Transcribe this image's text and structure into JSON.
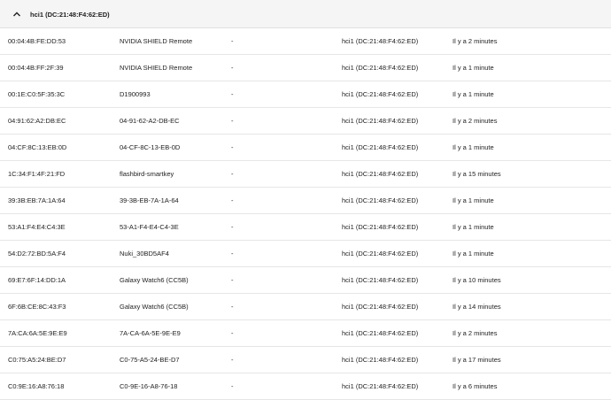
{
  "group": {
    "title": "hci1 (DC:21:48:F4:62:ED)",
    "icon": "chevron-up-icon"
  },
  "rows": [
    {
      "mac": "00:04:4B:FE:DD:53",
      "name": "NVIDIA SHIELD Remote",
      "extra": "-",
      "adapter": "hci1 (DC:21:48:F4:62:ED)",
      "last_seen": "Il y a 2 minutes"
    },
    {
      "mac": "00:04:4B:FF:2F:39",
      "name": "NVIDIA SHIELD Remote",
      "extra": "-",
      "adapter": "hci1 (DC:21:48:F4:62:ED)",
      "last_seen": "Il y a 1 minute"
    },
    {
      "mac": "00:1E:C0:5F:35:3C",
      "name": "D1900993",
      "extra": "-",
      "adapter": "hci1 (DC:21:48:F4:62:ED)",
      "last_seen": "Il y a 1 minute"
    },
    {
      "mac": "04:91:62:A2:DB:EC",
      "name": "04-91-62-A2-DB-EC",
      "extra": "-",
      "adapter": "hci1 (DC:21:48:F4:62:ED)",
      "last_seen": "Il y a 2 minutes"
    },
    {
      "mac": "04:CF:8C:13:EB:0D",
      "name": "04-CF-8C-13-EB-0D",
      "extra": "-",
      "adapter": "hci1 (DC:21:48:F4:62:ED)",
      "last_seen": "Il y a 1 minute"
    },
    {
      "mac": "1C:34:F1:4F:21:FD",
      "name": "flashbird-smartkey",
      "extra": "-",
      "adapter": "hci1 (DC:21:48:F4:62:ED)",
      "last_seen": "Il y a 15 minutes"
    },
    {
      "mac": "39:3B:EB:7A:1A:64",
      "name": "39-3B-EB-7A-1A-64",
      "extra": "-",
      "adapter": "hci1 (DC:21:48:F4:62:ED)",
      "last_seen": "Il y a 1 minute"
    },
    {
      "mac": "53:A1:F4:E4:C4:3E",
      "name": "53-A1-F4-E4-C4-3E",
      "extra": "-",
      "adapter": "hci1 (DC:21:48:F4:62:ED)",
      "last_seen": "Il y a 1 minute"
    },
    {
      "mac": "54:D2:72:BD:5A:F4",
      "name": "Nuki_30BD5AF4",
      "extra": "-",
      "adapter": "hci1 (DC:21:48:F4:62:ED)",
      "last_seen": "Il y a 1 minute"
    },
    {
      "mac": "69:E7:6F:14:DD:1A",
      "name": "Galaxy Watch6 (CC5B)",
      "extra": "-",
      "adapter": "hci1 (DC:21:48:F4:62:ED)",
      "last_seen": "Il y a 10 minutes"
    },
    {
      "mac": "6F:6B:CE:8C:43:F3",
      "name": "Galaxy Watch6 (CC5B)",
      "extra": "-",
      "adapter": "hci1 (DC:21:48:F4:62:ED)",
      "last_seen": "Il y a 14 minutes"
    },
    {
      "mac": "7A:CA:6A:5E:9E:E9",
      "name": "7A-CA-6A-5E-9E-E9",
      "extra": "-",
      "adapter": "hci1 (DC:21:48:F4:62:ED)",
      "last_seen": "Il y a 2 minutes"
    },
    {
      "mac": "C0:75:A5:24:BE:D7",
      "name": "C0-75-A5-24-BE-D7",
      "extra": "-",
      "adapter": "hci1 (DC:21:48:F4:62:ED)",
      "last_seen": "Il y a 17 minutes"
    },
    {
      "mac": "C0:9E:16:A8:76:18",
      "name": "C0-9E-16-A8-76-18",
      "extra": "-",
      "adapter": "hci1 (DC:21:48:F4:62:ED)",
      "last_seen": "Il y a 6 minutes"
    }
  ]
}
